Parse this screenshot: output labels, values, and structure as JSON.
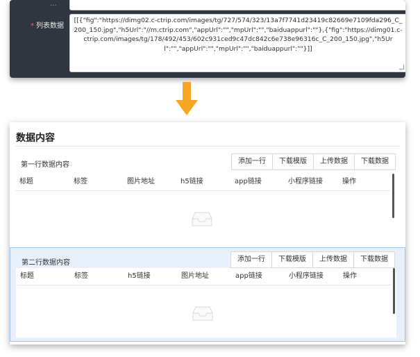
{
  "top_form": {
    "stub_label": "...",
    "list_field": {
      "required_mark": "*",
      "label": "列表数据",
      "value": "[[{\"fig\":\"https://dimg02.c-ctrip.com/images/tg/727/574/323/13a7f7741d23419c82669e7109fda296_C_200_150.jpg\",\"h5Url\":\"//m.ctrip.com\",\"appUrl\":\"\",\"mpUrl\":\"\",\"baiduappurl\":\"\"},{\"fig\":\"https://dimg01.c-ctrip.com/images/tg/178/492/453/602c931ced9c47dc842c6e738e96316c_C_200_150.jpg\",\"h5Url\":\"\",\"appUrl\":\"\",\"mpUrl\":\"\",\"baiduappurl\":\"\"}]]"
    }
  },
  "arrow": {
    "color": "#f5a623"
  },
  "panel": {
    "title": "数据内容",
    "sections": [
      {
        "title": "第一行数据内容",
        "buttons": [
          "添加一行",
          "下载模版",
          "上传数据",
          "下载数据"
        ],
        "columns": [
          "标题",
          "标签",
          "图片地址",
          "h5链接",
          "app链接",
          "小程序链接",
          "操作"
        ]
      },
      {
        "title": "第二行数据内容",
        "buttons": [
          "添加一行",
          "下载模版",
          "上传数据",
          "下载数据"
        ],
        "columns": [
          "标题",
          "标签",
          "h5链接",
          "图片地址",
          "app链接",
          "小程序链接",
          "操作"
        ]
      }
    ]
  },
  "colors": {
    "form_bg": "#2f3640",
    "selected_section_bg": "#e8f1fb",
    "selected_section_border": "#9cc3e8"
  }
}
